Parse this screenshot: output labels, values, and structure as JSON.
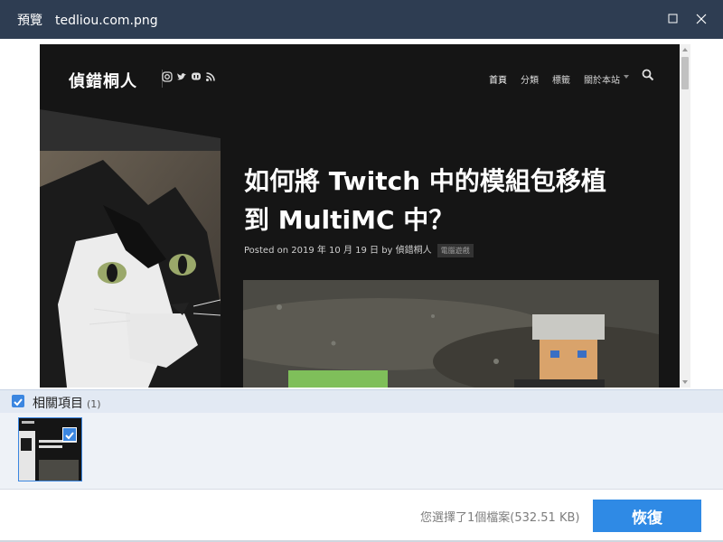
{
  "window": {
    "title": "預覽",
    "filename": "tedliou.com.png"
  },
  "preview": {
    "site_name": "偵錯桐人",
    "nav": [
      "首頁",
      "分類",
      "標籤",
      "關於本站"
    ],
    "post_title_line1": "如何將 Twitch 中的模組包移植",
    "post_title_line2": "到 MultiMC 中？",
    "post_meta": "Posted on 2019 年 10 月 19 日 by 偵錯桐人",
    "post_category": "電腦遊戲"
  },
  "related": {
    "label": "相關項目",
    "count": "(1)",
    "thumbnail_title": "如何將 Twitch 中的模組包移植到 MultiMC 中？"
  },
  "footer": {
    "status": "您選擇了1個檔案(532.51 KB)",
    "recover_label": "恢復"
  },
  "colors": {
    "titlebar": "#2e3d52",
    "accent": "#2f8ae5",
    "site_bg": "#151515"
  },
  "icons": [
    "maximize-icon",
    "close-icon",
    "instagram-icon",
    "twitter-icon",
    "mastodon-icon",
    "rss-icon",
    "search-icon",
    "checkmark-icon"
  ]
}
